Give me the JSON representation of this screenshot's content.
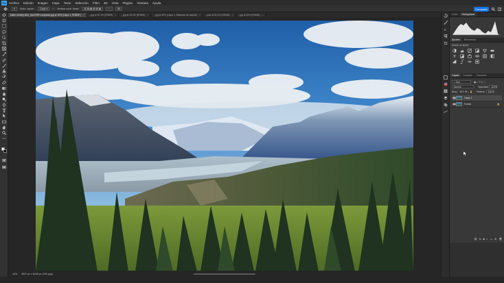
{
  "menubar": {
    "app_icon": "Ps",
    "items": [
      "Archivo",
      "Edición",
      "Imagen",
      "Capa",
      "Texto",
      "Selección",
      "Filtro",
      "3D",
      "Vista",
      "Plugins",
      "Ventana",
      "Ayuda"
    ]
  },
  "options": {
    "tool_icon": "move-tool-icon",
    "auto_select_label": "Selec. autom.:",
    "auto_select_value": "Capa",
    "transform_label": "Mostrar contr. transf.",
    "share_label": "Compartir"
  },
  "tabs": [
    {
      "label": "kalen-emsley-Bk3_HpnOtRH-unsplash.jpg al 16% (Capa 1, RGB/8*)",
      "active": true
    },
    {
      "label": "...jpg al 16,1% (RGB/8)",
      "active": false
    },
    {
      "label": "...jpg al 33,3% (RGB/8)",
      "active": false
    },
    {
      "label": "...jpg al 50% (Capa 1, Máscara de capa/8)",
      "active": false
    },
    {
      "label": "...psd al 33,3% (RGB/8)",
      "active": false
    },
    {
      "label": "...jpg al 25% (RGB/8)",
      "active": false
    }
  ],
  "status": {
    "zoom": "16%",
    "doc_info": "9537 px x 6238 px (300 ppp)"
  },
  "panels": {
    "top_tabs": [
      "Color",
      "Histograma"
    ],
    "adjust_tabs": [
      "Ajustes",
      "Bibliotecas"
    ],
    "adjust_subtitle": "Añadir un ajuste",
    "layer_tabs": [
      "Capas",
      "Canales",
      "Trazados"
    ],
    "search_placeholder": "Tipo",
    "blend_mode": "Normal",
    "opacity_label": "Opacidad:",
    "opacity_value": "100%",
    "lock_label": "Bloq.:",
    "fill_label": "Relleno:",
    "fill_value": "100%",
    "layers": [
      {
        "name": "Capa 1",
        "selected": true
      },
      {
        "name": "Fondo",
        "selected": false
      }
    ]
  },
  "colors": {
    "accent": "#1473e6",
    "app_blue": "#31a8ff",
    "ui_dark": "#262626",
    "panel": "#383838"
  }
}
